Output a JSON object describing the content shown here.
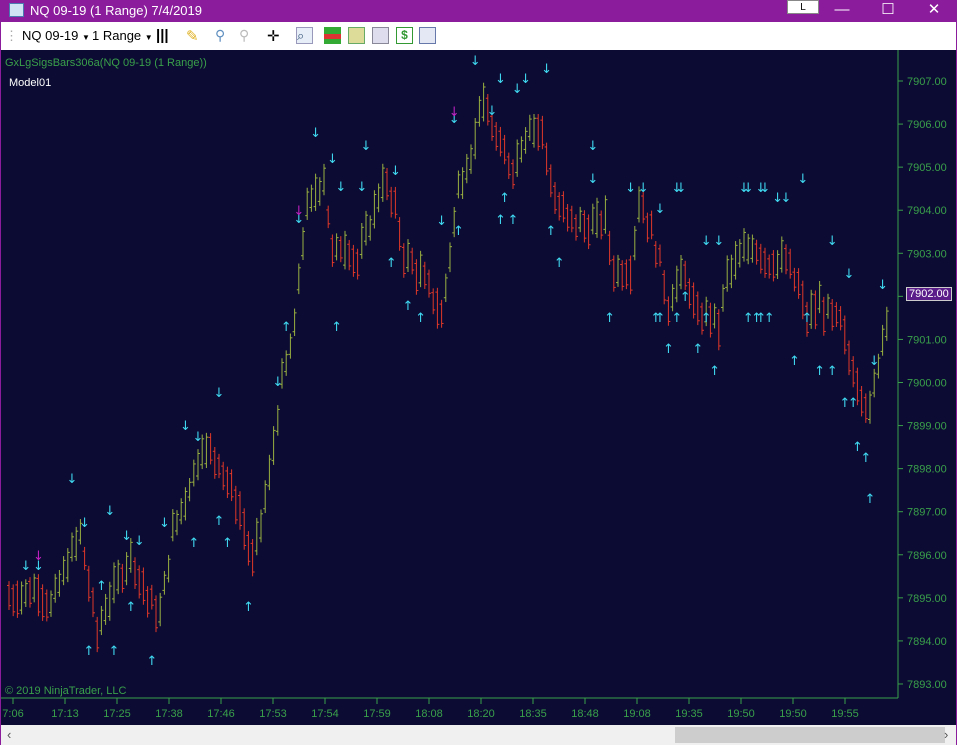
{
  "window": {
    "title": "NQ 09-19 (1 Range)  7/4/2019",
    "l_button": "L",
    "minimize": "—",
    "maximize": "☐",
    "close": "✕"
  },
  "toolbar": {
    "instrument": "NQ 09-19",
    "interval": "1 Range",
    "icons": [
      "bar-style-icon",
      "pencil-draw-icon",
      "zoom-in-icon",
      "zoom-out-icon",
      "crosshair-icon",
      "search-icon",
      "strategies-icon",
      "indicators-icon",
      "chart-properties-icon",
      "dollar-icon",
      "data-box-icon"
    ]
  },
  "chart": {
    "indicator_label": "GxLgSigsBars306a(NQ 09-19 (1 Range))",
    "model_label": "Model01",
    "copyright": "© 2019 NinjaTrader, LLC",
    "current_price": "7902.00",
    "colors": {
      "background": "#0b0b33",
      "axis": "#3aa04a",
      "up_bar": "#9ab040",
      "down_bar": "#e03828",
      "arrow": "#40d8f0",
      "alt_arrow": "#c020c0",
      "price_tag": "#5a1d8a"
    }
  },
  "chart_data": {
    "type": "bar",
    "title": "NQ 09-19 (1 Range)",
    "ylim": [
      7892.6,
      7907.7
    ],
    "y_ticks": [
      "7893.00",
      "7894.00",
      "7895.00",
      "7896.00",
      "7897.00",
      "7898.00",
      "7899.00",
      "7900.00",
      "7901.00",
      "7902.00",
      "7903.00",
      "7904.00",
      "7905.00",
      "7906.00",
      "7907.00"
    ],
    "x_ticks": [
      "7:06",
      "17:13",
      "17:25",
      "17:38",
      "17:46",
      "17:53",
      "17:54",
      "17:59",
      "18:08",
      "18:20",
      "18:35",
      "18:48",
      "19:08",
      "19:35",
      "19:50",
      "19:50",
      "19:55"
    ],
    "bar_count": 210,
    "path": [
      [
        0,
        7895
      ],
      [
        7,
        7895.2
      ],
      [
        10,
        7894.8
      ],
      [
        14,
        7895.8
      ],
      [
        17,
        7896.5
      ],
      [
        21,
        7894.2
      ],
      [
        24,
        7895
      ],
      [
        29,
        7896
      ],
      [
        33,
        7895
      ],
      [
        36,
        7894.6
      ],
      [
        39,
        7896.5
      ],
      [
        43,
        7897.6
      ],
      [
        46,
        7898.5
      ],
      [
        50,
        7898.2
      ],
      [
        55,
        7897
      ],
      [
        58,
        7895.8
      ],
      [
        62,
        7897.8
      ],
      [
        65,
        7900
      ],
      [
        68,
        7901.2
      ],
      [
        69,
        7902.5
      ],
      [
        71,
        7904
      ],
      [
        75,
        7904.8
      ],
      [
        77,
        7903
      ],
      [
        80,
        7903.2
      ],
      [
        83,
        7902.8
      ],
      [
        87,
        7904
      ],
      [
        89,
        7904.7
      ],
      [
        92,
        7904
      ],
      [
        94,
        7903
      ],
      [
        98,
        7902.5
      ],
      [
        101,
        7902
      ],
      [
        103,
        7901.5
      ],
      [
        105,
        7903
      ],
      [
        107,
        7904.5
      ],
      [
        111,
        7905.6
      ],
      [
        112,
        7906.5
      ],
      [
        114,
        7906.2
      ],
      [
        117,
        7905.4
      ],
      [
        120,
        7905
      ],
      [
        124,
        7906
      ],
      [
        127,
        7905.8
      ],
      [
        130,
        7904.2
      ],
      [
        133,
        7903.8
      ],
      [
        138,
        7903.6
      ],
      [
        142,
        7903.8
      ],
      [
        144,
        7902.6
      ],
      [
        148,
        7902.6
      ],
      [
        150,
        7904.2
      ],
      [
        152,
        7903.8
      ],
      [
        155,
        7902.8
      ],
      [
        157,
        7901.8
      ],
      [
        160,
        7902.5
      ],
      [
        162,
        7902.2
      ],
      [
        164,
        7901.5
      ],
      [
        167,
        7901.6
      ],
      [
        169,
        7901.3
      ],
      [
        171,
        7902.5
      ],
      [
        175,
        7903
      ],
      [
        177,
        7903.2
      ],
      [
        181,
        7902.8
      ],
      [
        185,
        7902.8
      ],
      [
        188,
        7902.2
      ],
      [
        190,
        7901.5
      ],
      [
        193,
        7901.8
      ],
      [
        195,
        7901.6
      ],
      [
        198,
        7901.4
      ],
      [
        200,
        7900.6
      ],
      [
        202,
        7900
      ],
      [
        205,
        7899.3
      ],
      [
        207,
        7900.5
      ],
      [
        209,
        7901.6
      ]
    ],
    "signals": [
      [
        4,
        7895.76,
        "down"
      ],
      [
        7,
        7895.76,
        "down"
      ],
      [
        7,
        7896.0,
        "down-alt"
      ],
      [
        15,
        7897.78,
        "down"
      ],
      [
        18,
        7896.76,
        "down"
      ],
      [
        24,
        7897.04,
        "down"
      ],
      [
        28,
        7896.46,
        "down"
      ],
      [
        31,
        7896.34,
        "down"
      ],
      [
        37,
        7896.76,
        "down"
      ],
      [
        42,
        7899.01,
        "down"
      ],
      [
        45,
        7898.76,
        "down"
      ],
      [
        50,
        7899.78,
        "down"
      ],
      [
        64,
        7900.03,
        "down"
      ],
      [
        69,
        7903.82,
        "down"
      ],
      [
        69,
        7904.0,
        "down-alt"
      ],
      [
        73,
        7905.82,
        "down"
      ],
      [
        77,
        7905.21,
        "down"
      ],
      [
        79,
        7904.56,
        "down"
      ],
      [
        84,
        7904.56,
        "down"
      ],
      [
        85,
        7905.51,
        "down"
      ],
      [
        92,
        7904.93,
        "down"
      ],
      [
        103,
        7903.77,
        "down"
      ],
      [
        106,
        7906.14,
        "down"
      ],
      [
        106,
        7906.3,
        "down-alt"
      ],
      [
        111,
        7907.49,
        "down"
      ],
      [
        115,
        7906.33,
        "down"
      ],
      [
        117,
        7907.07,
        "down"
      ],
      [
        121,
        7906.84,
        "down"
      ],
      [
        123,
        7907.07,
        "down"
      ],
      [
        128,
        7907.3,
        "down"
      ],
      [
        139,
        7905.51,
        "down"
      ],
      [
        139,
        7904.75,
        "down"
      ],
      [
        148,
        7904.54,
        "down"
      ],
      [
        151,
        7904.54,
        "down"
      ],
      [
        155,
        7904.05,
        "down"
      ],
      [
        159,
        7904.54,
        "down"
      ],
      [
        160,
        7904.54,
        "down"
      ],
      [
        166,
        7903.31,
        "down"
      ],
      [
        169,
        7903.31,
        "down"
      ],
      [
        175,
        7904.54,
        "down"
      ],
      [
        176,
        7904.54,
        "down"
      ],
      [
        179,
        7904.54,
        "down"
      ],
      [
        180,
        7904.54,
        "down"
      ],
      [
        183,
        7904.31,
        "down"
      ],
      [
        185,
        7904.31,
        "down"
      ],
      [
        189,
        7904.75,
        "down"
      ],
      [
        196,
        7903.31,
        "down"
      ],
      [
        200,
        7902.54,
        "down"
      ],
      [
        206,
        7900.52,
        "down"
      ],
      [
        208,
        7902.29,
        "down"
      ],
      [
        19,
        7893.79,
        "up"
      ],
      [
        22,
        7895.3,
        "up"
      ],
      [
        25,
        7893.79,
        "up"
      ],
      [
        29,
        7894.81,
        "up"
      ],
      [
        34,
        7893.56,
        "up"
      ],
      [
        44,
        7896.3,
        "up"
      ],
      [
        50,
        7896.81,
        "up"
      ],
      [
        52,
        7896.3,
        "up"
      ],
      [
        57,
        7894.81,
        "up"
      ],
      [
        66,
        7901.31,
        "up"
      ],
      [
        78,
        7901.31,
        "up"
      ],
      [
        91,
        7902.8,
        "up"
      ],
      [
        95,
        7901.8,
        "up"
      ],
      [
        98,
        7901.52,
        "up"
      ],
      [
        107,
        7903.54,
        "up"
      ],
      [
        117,
        7903.8,
        "up"
      ],
      [
        118,
        7904.31,
        "up"
      ],
      [
        120,
        7903.8,
        "up"
      ],
      [
        129,
        7903.54,
        "up"
      ],
      [
        131,
        7902.8,
        "up"
      ],
      [
        143,
        7901.52,
        "up"
      ],
      [
        154,
        7901.52,
        "up"
      ],
      [
        155,
        7901.52,
        "up"
      ],
      [
        157,
        7900.8,
        "up"
      ],
      [
        159,
        7901.52,
        "up"
      ],
      [
        161,
        7902.01,
        "up"
      ],
      [
        164,
        7900.8,
        "up"
      ],
      [
        166,
        7901.52,
        "up"
      ],
      [
        168,
        7900.29,
        "up"
      ],
      [
        176,
        7901.52,
        "up"
      ],
      [
        178,
        7901.52,
        "up"
      ],
      [
        179,
        7901.52,
        "up"
      ],
      [
        181,
        7901.52,
        "up"
      ],
      [
        187,
        7900.52,
        "up"
      ],
      [
        190,
        7901.52,
        "up"
      ],
      [
        193,
        7900.29,
        "up"
      ],
      [
        196,
        7900.29,
        "up"
      ],
      [
        199,
        7899.55,
        "up"
      ],
      [
        201,
        7899.55,
        "up"
      ],
      [
        202,
        7898.53,
        "up"
      ],
      [
        204,
        7898.27,
        "up"
      ],
      [
        205,
        7897.32,
        "up"
      ]
    ]
  }
}
